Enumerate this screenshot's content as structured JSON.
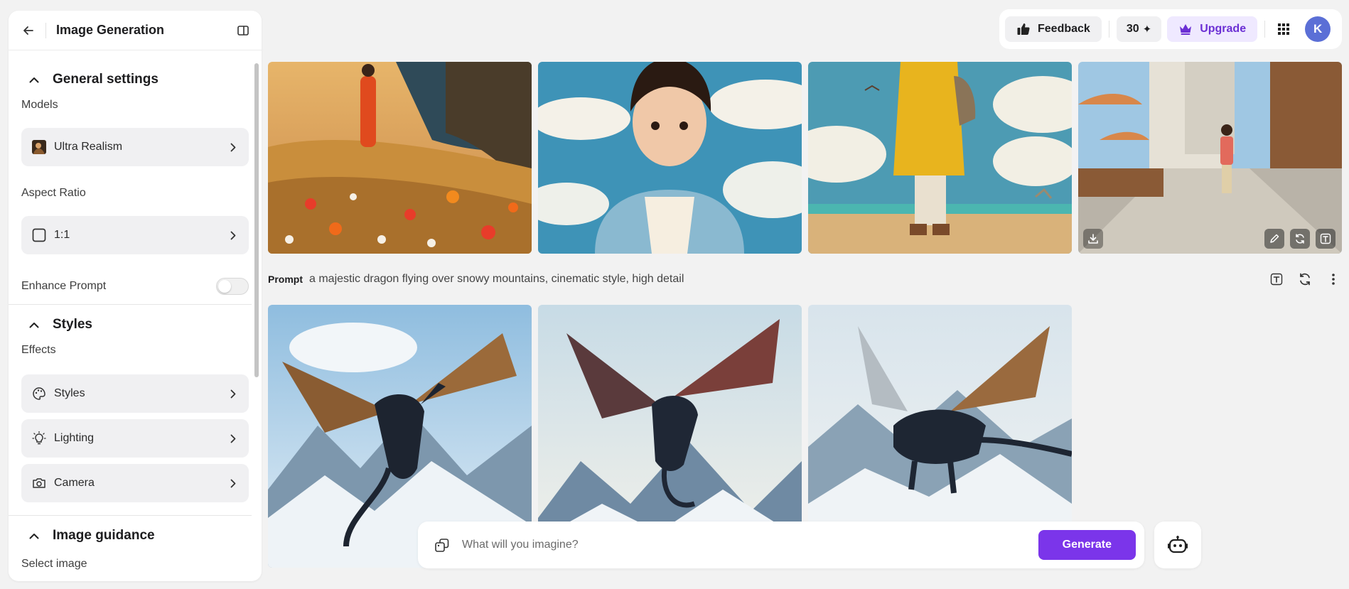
{
  "sidebar": {
    "title": "Image Generation",
    "general_settings": {
      "heading": "General settings",
      "models_label": "Models",
      "model_value": "Ultra Realism",
      "aspect_ratio_label": "Aspect Ratio",
      "aspect_ratio_value": "1:1",
      "enhance_prompt_label": "Enhance Prompt",
      "enhance_prompt_on": false
    },
    "styles": {
      "heading": "Styles",
      "effects_label": "Effects",
      "items": [
        {
          "label": "Styles",
          "icon": "palette-icon"
        },
        {
          "label": "Lighting",
          "icon": "lightbulb-icon"
        },
        {
          "label": "Camera",
          "icon": "camera-icon"
        }
      ]
    },
    "image_guidance": {
      "heading": "Image guidance",
      "select_image_label": "Select image"
    }
  },
  "topbar": {
    "feedback_label": "Feedback",
    "credits": "30",
    "upgrade_label": "Upgrade",
    "avatar_initial": "K"
  },
  "gallery": {
    "row1_images": [
      {
        "subject": "woman-in-red-dress-flower-field"
      },
      {
        "subject": "young-girl-sky-clouds"
      },
      {
        "subject": "figure-yellow-coat-beach"
      },
      {
        "subject": "woman-walking-cafe-street"
      }
    ],
    "prompt_label": "Prompt",
    "prompt_text": "a majestic dragon flying over snowy mountains, cinematic style, high detail",
    "row2_images": [
      {
        "subject": "dragon-snowy-mountains-1"
      },
      {
        "subject": "dragon-snowy-mountains-2"
      },
      {
        "subject": "dragon-snowy-mountains-3"
      }
    ]
  },
  "composer": {
    "placeholder": "What will you imagine?",
    "generate_label": "Generate"
  },
  "colors": {
    "accent": "#7b35ea",
    "upgrade_bg": "#efe9ff",
    "upgrade_text": "#6b2fd4",
    "avatar_bg": "#5b6fd6"
  }
}
